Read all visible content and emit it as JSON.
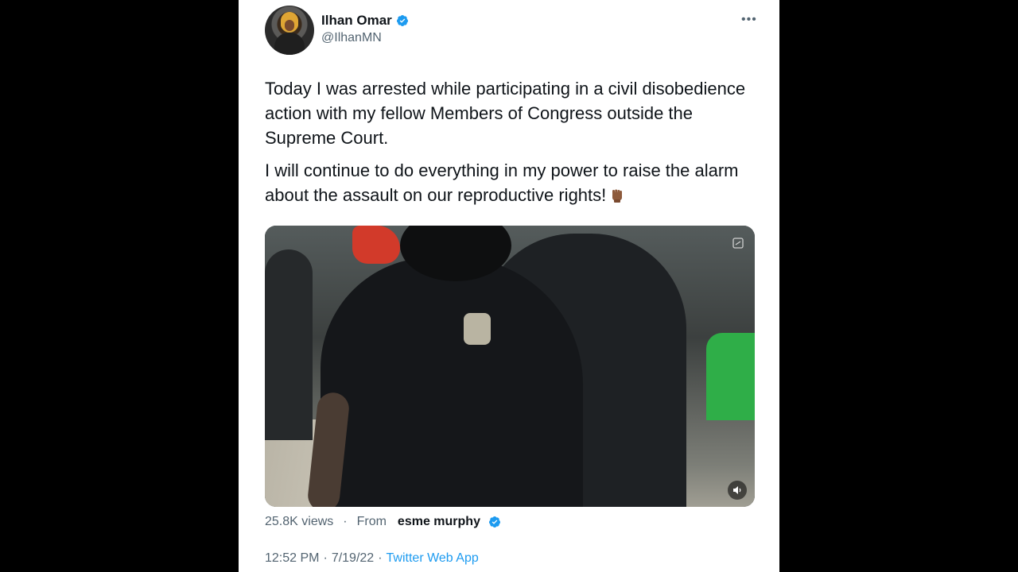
{
  "author": {
    "name": "Ilhan Omar",
    "handle": "@IlhanMN",
    "verified": true
  },
  "tweet": {
    "paragraphs": [
      "Today I was arrested while participating in a civil disobedience action with my fellow Members of Congress outside the Supreme Court.",
      "I will continue to do everything in my power to raise the alarm about the assault on our reproductive rights!"
    ],
    "emoji": "raised-fist-emoji"
  },
  "media": {
    "type": "video",
    "gif_icon": "gif-icon",
    "sound_icon": "speaker-muted-icon"
  },
  "stats": {
    "views": "25.8K views",
    "separator": "·",
    "from_label": "From",
    "from_user": "esme murphy"
  },
  "timestamp": {
    "time": "12:52 PM",
    "sep1": "·",
    "date": "7/19/22",
    "sep2": "·",
    "app": "Twitter Web App"
  },
  "colors": {
    "accent": "#1d9bf0",
    "text": "#0f1419",
    "secondary": "#536471"
  }
}
